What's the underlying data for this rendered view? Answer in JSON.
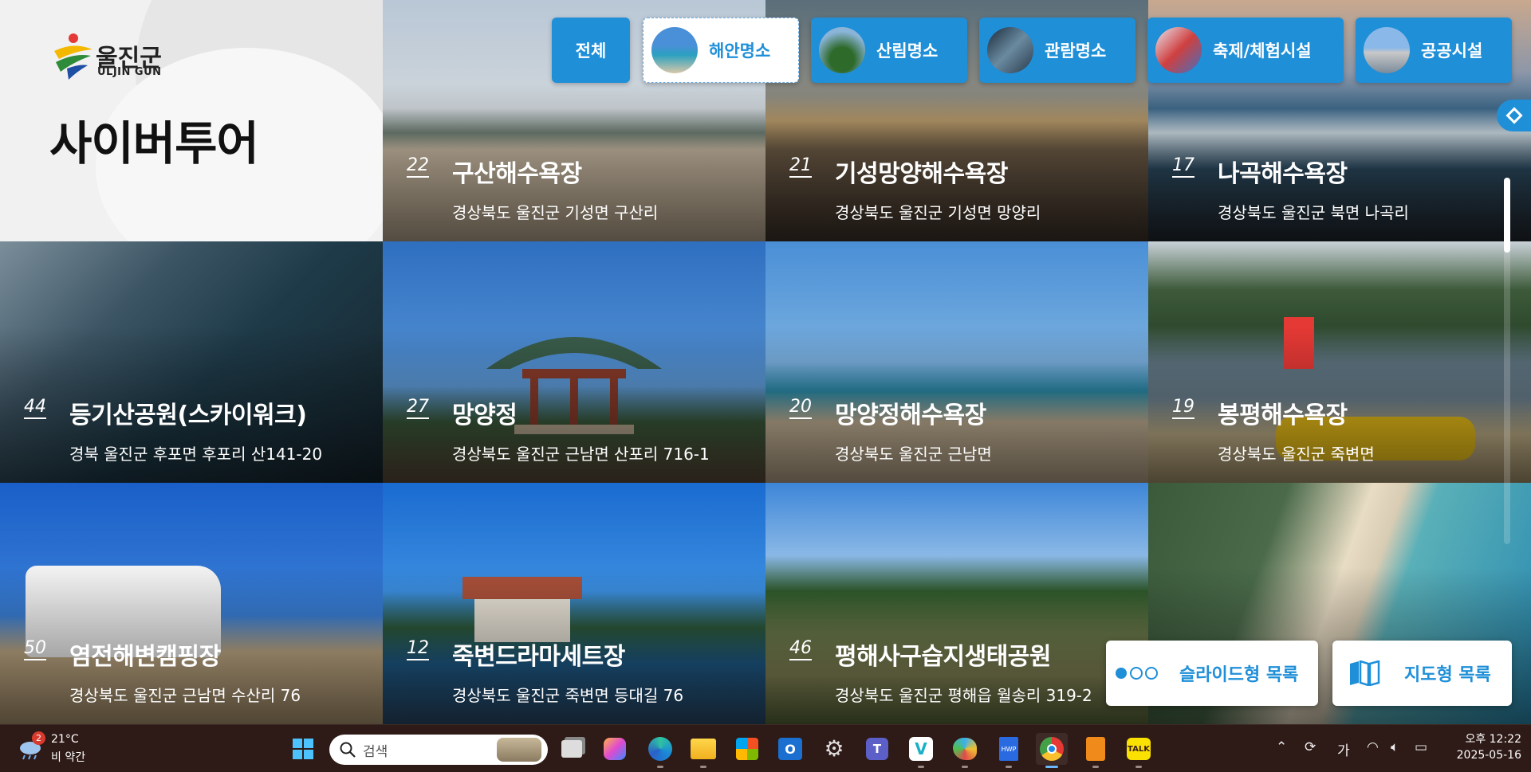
{
  "logo": {
    "name_kr": "울진군",
    "name_en": "ULJIN GUN"
  },
  "page_title": "사이버투어",
  "categories": [
    {
      "label": "전체",
      "active": false
    },
    {
      "label": "해안명소",
      "active": true
    },
    {
      "label": "산림명소",
      "active": false
    },
    {
      "label": "관람명소",
      "active": false
    },
    {
      "label": "축제/체험시설",
      "active": false
    },
    {
      "label": "공공시설",
      "active": false
    }
  ],
  "tiles": [
    {
      "num": "22",
      "title": "구산해수욕장",
      "address": "경상북도 울진군 기성면 구산리"
    },
    {
      "num": "21",
      "title": "기성망양해수욕장",
      "address": "경상북도 울진군 기성면 망양리"
    },
    {
      "num": "17",
      "title": "나곡해수욕장",
      "address": "경상북도 울진군 북면 나곡리"
    },
    {
      "num": "44",
      "title": "등기산공원(스카이워크)",
      "address": "경북 울진군 후포면 후포리 산141-20"
    },
    {
      "num": "27",
      "title": "망양정",
      "address": "경상북도 울진군 근남면 산포리 716-1"
    },
    {
      "num": "20",
      "title": "망양정해수욕장",
      "address": "경상북도 울진군 근남면"
    },
    {
      "num": "19",
      "title": "봉평해수욕장",
      "address": "경상북도 울진군 죽변면"
    },
    {
      "num": "50",
      "title": "염전해변캠핑장",
      "address": "경상북도 울진군 근남면 수산리 76"
    },
    {
      "num": "12",
      "title": "죽변드라마세트장",
      "address": "경상북도 울진군 죽변면 등대길 76"
    },
    {
      "num": "46",
      "title": "평해사구습지생태공원",
      "address": "경상북도 울진군 평해읍 월송리 319-2"
    },
    {
      "num": "",
      "title": "",
      "address": ""
    }
  ],
  "view_buttons": {
    "slide": "슬라이드형 목록",
    "map": "지도형 목록"
  },
  "taskbar": {
    "weather_temp": "21°C",
    "weather_desc": "비 약간",
    "weather_badge": "2",
    "search_placeholder": "검색",
    "ime": "가",
    "time": "오후 12:22",
    "date": "2025-05-16"
  },
  "colors": {
    "accent": "#1f8fd8",
    "taskbar": "#2e1a16"
  }
}
